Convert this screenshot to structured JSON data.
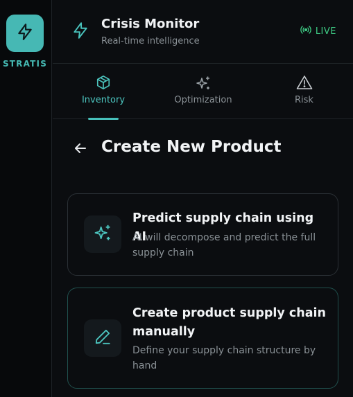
{
  "brand": {
    "name": "STRATIS",
    "logo_icon": "bolt-icon",
    "accent": "#46b8b4"
  },
  "header": {
    "title": "Crisis Monitor",
    "subtitle": "Real-time intelligence",
    "status": {
      "label": "LIVE",
      "icon": "broadcast-icon",
      "color": "#3fce86"
    }
  },
  "tabs": [
    {
      "label": "Inventory",
      "icon": "box-icon",
      "active": true
    },
    {
      "label": "Optimization",
      "icon": "sparkles-icon",
      "active": false
    },
    {
      "label": "Risk",
      "icon": "warning-icon",
      "active": false
    }
  ],
  "page": {
    "title": "Create New Product",
    "back_icon": "arrow-left-icon"
  },
  "options": [
    {
      "title": "Predict supply chain using AI",
      "description": "AI will decompose and predict the full supply chain",
      "icon": "sparkles-icon"
    },
    {
      "title": "Create product supply chain manually",
      "description": "Define your supply chain structure by hand",
      "icon": "pencil-icon"
    }
  ]
}
